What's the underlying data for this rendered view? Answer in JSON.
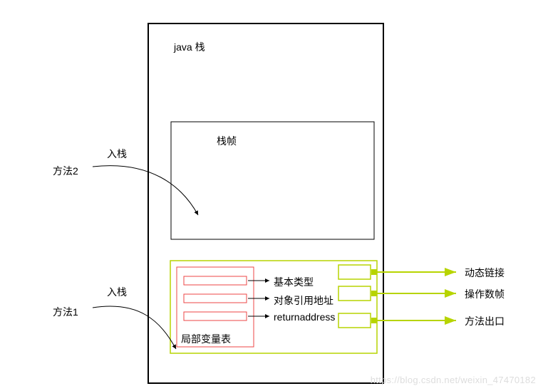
{
  "title": "java 栈",
  "method2_label": "方法2",
  "method2_push": "入栈",
  "method1_label": "方法1",
  "method1_push": "入栈",
  "frame_title": "栈帧",
  "lvt_title": "局部变量表",
  "row1": "基本类型",
  "row2": "对象引用地址",
  "row3": "returnaddress",
  "right1": "动态链接",
  "right2": "操作数帧",
  "right3": "方法出口",
  "watermark": "https://blog.csdn.net/weixin_47470182"
}
